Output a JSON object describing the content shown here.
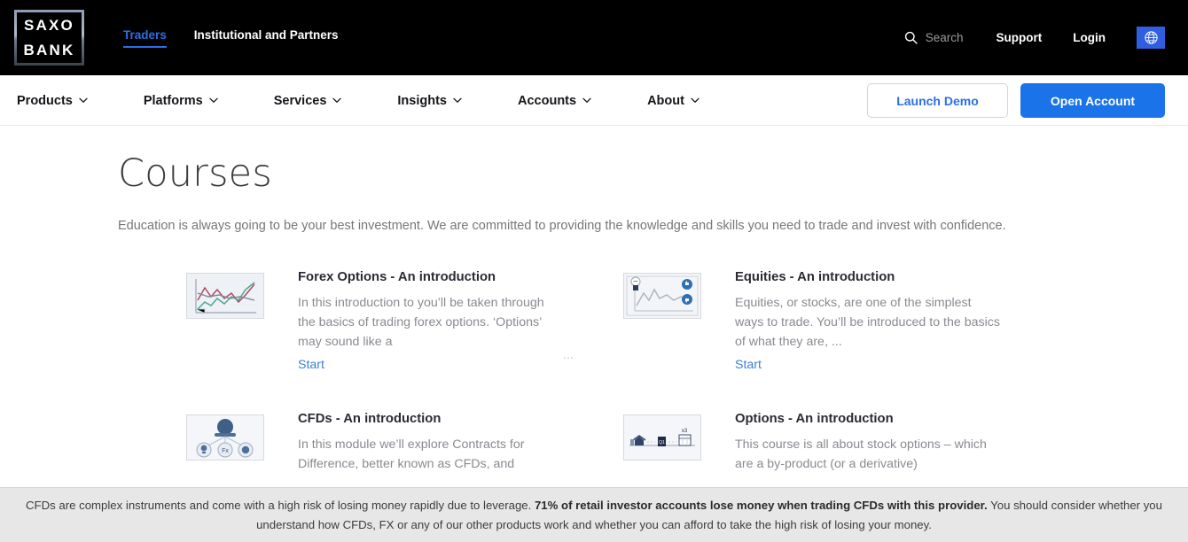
{
  "header": {
    "logo": {
      "line1": "SAXO",
      "line2": "BANK",
      "name": "saxo-bank-logo"
    },
    "tabs": [
      {
        "label": "Traders",
        "active": true
      },
      {
        "label": "Institutional and Partners",
        "active": false
      }
    ],
    "search": {
      "label": "Search",
      "icon": "search-icon"
    },
    "links": [
      {
        "label": "Support"
      },
      {
        "label": "Login"
      }
    ],
    "language_button": {
      "icon": "globe-icon",
      "color": "#2f5fe0"
    }
  },
  "nav": {
    "items": [
      {
        "label": "Products",
        "icon": "chevron-down-icon"
      },
      {
        "label": "Platforms",
        "icon": "chevron-down-icon"
      },
      {
        "label": "Services",
        "icon": "chevron-down-icon"
      },
      {
        "label": "Insights",
        "icon": "chevron-down-icon"
      },
      {
        "label": "Accounts",
        "icon": "chevron-down-icon"
      },
      {
        "label": "About",
        "icon": "chevron-down-icon"
      }
    ],
    "demo_button": "Launch Demo",
    "open_account_button": "Open Account"
  },
  "page": {
    "title": "Courses",
    "subtitle": "Education is always going to be your best investment. We are committed to providing the knowledge and skills you need to trade and invest with confidence.",
    "ellipsis": "..."
  },
  "courses": [
    {
      "title": "Forex Options - An introduction",
      "description": "In this introduction to you’ll be taken through the basics of trading forex options. ‘Options’ may sound like a",
      "start": "Start",
      "thumb": "line-chart-thumbnail"
    },
    {
      "title": "Equities - An introduction",
      "description": "Equities, or stocks, are one of the simplest ways to trade. You’ll be introduced to the basics of what they are, ...",
      "start": "Start",
      "thumb": "equities-chart-thumbnail"
    },
    {
      "title": "CFDs - An introduction",
      "description": "In this module we’ll explore Contracts for Difference, better known as CFDs, and",
      "start": "",
      "thumb": "network-diagram-thumbnail"
    },
    {
      "title": "Options - An introduction",
      "description": "This course is all about stock options – which are a by-product (or a derivative)",
      "start": "",
      "thumb": "houses-x3-thumbnail"
    }
  ],
  "disclaimer": {
    "part1": "CFDs are complex instruments and come with a high risk of losing money rapidly due to leverage.",
    "bold": "71% of retail investor accounts lose money when trading CFDs with this provider.",
    "part2": "You should consider whether you understand how CFDs, FX or any of our other products work and whether you can afford to take the high risk of losing your money."
  },
  "colors": {
    "accent_blue": "#1a73e8",
    "link_blue": "#3d7fd6",
    "header_black": "#000000",
    "disclaimer_bg": "#e7e7e7"
  }
}
